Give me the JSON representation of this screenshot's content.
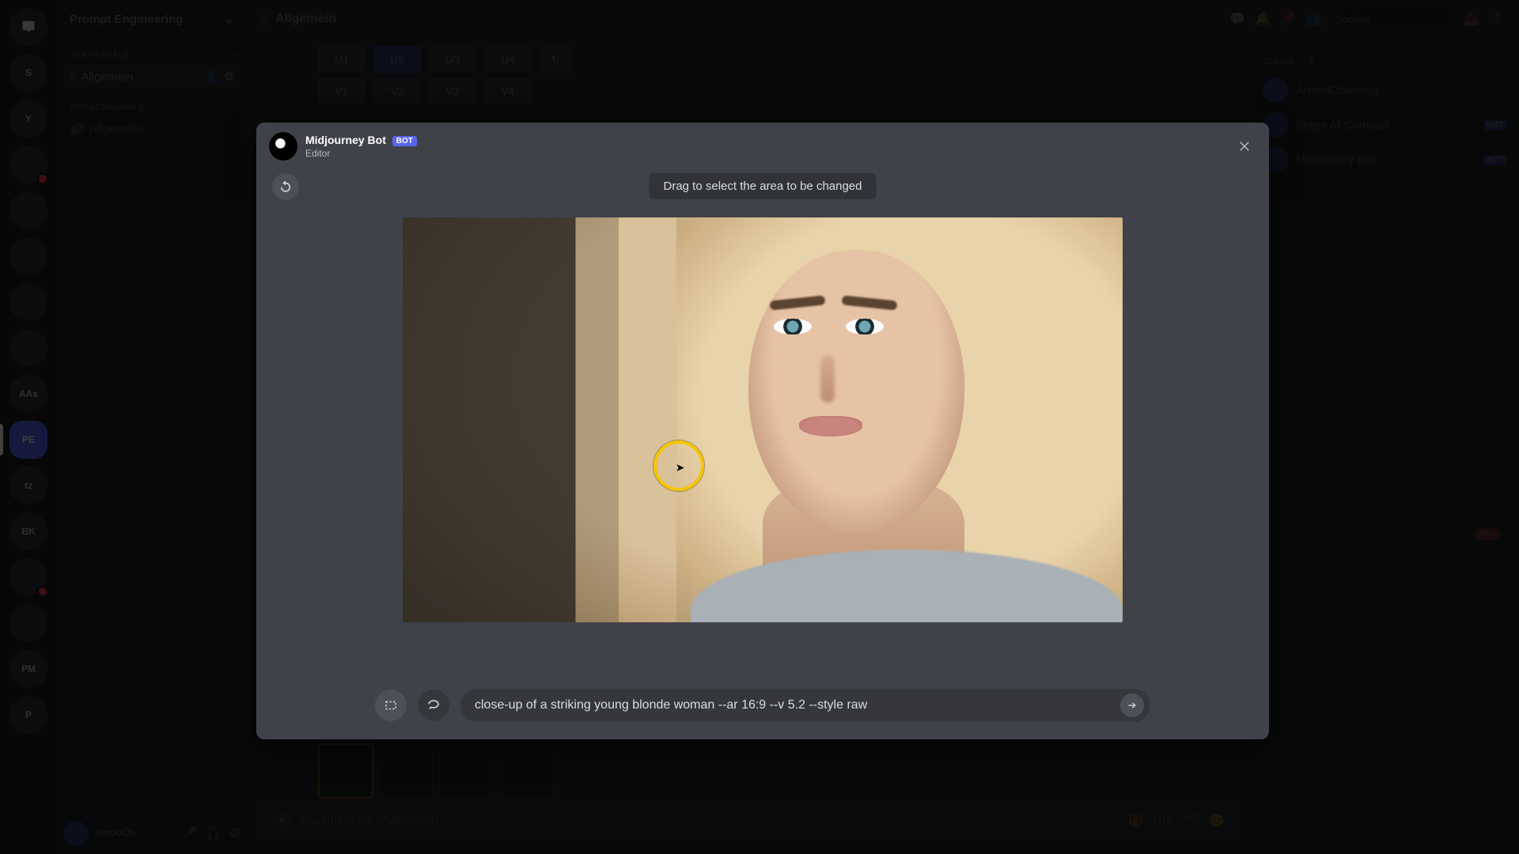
{
  "app": {
    "server_name": "Prompt Engineering",
    "channel_name": "Allgemein",
    "search_placeholder": "Suchen"
  },
  "sections": {
    "text_channels": "TEXTKANÄLE",
    "voice_channels": "SPRACHKANÄLE"
  },
  "channels": {
    "general": "Allgemein",
    "voice1": "Allgemein"
  },
  "user": {
    "name": "ArnoldOb...",
    "status": ""
  },
  "members": {
    "section": "ONLINE — 3",
    "items": [
      {
        "name": "ArnoldObeleniu...",
        "bot": false
      },
      {
        "name": "Stage AI Compan...",
        "bot": true
      },
      {
        "name": "Midjourney Bot",
        "bot": true
      }
    ]
  },
  "mj_buttons": {
    "u1": "U1",
    "u2": "U2",
    "u3": "U3",
    "u4": "U4",
    "v1": "V1",
    "v2": "V2",
    "v3": "V3",
    "v4": "V4",
    "redo": "↻"
  },
  "message_input": {
    "placeholder": "Nachricht an #Allgemein"
  },
  "modal": {
    "bot_name": "Midjourney Bot",
    "bot_tag": "BOT",
    "subtitle": "Editor",
    "hint": "Drag to select the area to be changed",
    "prompt": "close-up of a striking young blonde woman --ar 16:9 --v 5.2 --style raw"
  },
  "badges": {
    "new": "NEU"
  }
}
